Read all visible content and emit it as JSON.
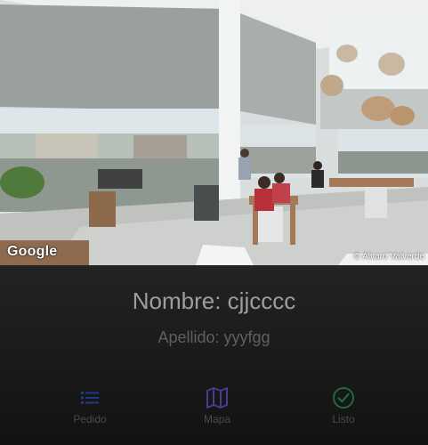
{
  "image": {
    "watermark": "Google",
    "credit": "© Alvaro Valverde"
  },
  "profile": {
    "name": "Nombre: cjjcccc",
    "surname": "Apellido: yyyfgg"
  },
  "nav": {
    "items": [
      {
        "label": "Pedido",
        "icon": "list-icon",
        "color": "#1e3a8a"
      },
      {
        "label": "Mapa",
        "icon": "map-icon",
        "color": "#4b3b8f"
      },
      {
        "label": "Listo",
        "icon": "check-circle-icon",
        "color": "#1f6b3c"
      }
    ]
  }
}
